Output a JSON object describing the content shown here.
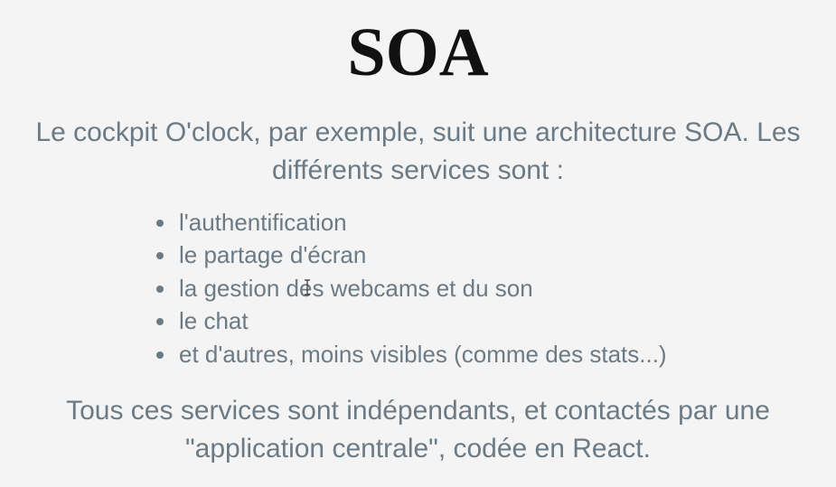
{
  "slide": {
    "title": "SOA",
    "intro": "Le cockpit O'clock, par exemple, suit une architecture SOA. Les différents services sont :",
    "services": [
      "l'authentification",
      "le partage d'écran",
      "la gestion des webcams et du son",
      "le chat",
      "et d'autres, moins visibles (comme des stats...)"
    ],
    "outro": "Tous ces services sont indépendants, et contactés par une \"application centrale\", codée en React."
  },
  "colors": {
    "background": "#f4f4f4",
    "title": "#111111",
    "body_text": "#6b7a84"
  },
  "cursor": {
    "icon": "text-cursor-icon"
  }
}
